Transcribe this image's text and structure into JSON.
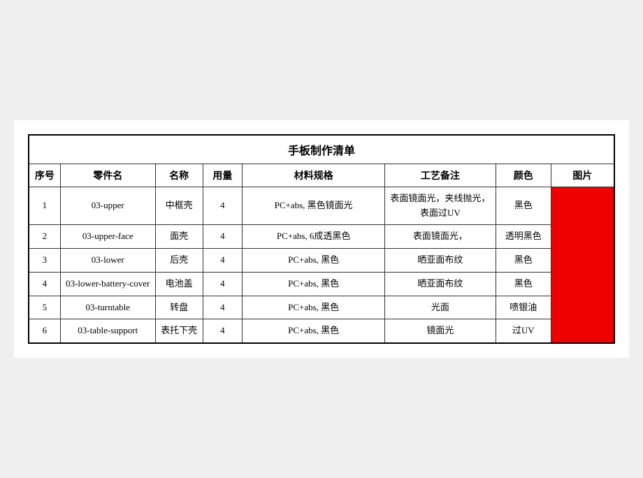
{
  "title": "手板制作清单",
  "headers": {
    "seq": "序号",
    "part_code": "零件名",
    "name": "名称",
    "qty": "用量",
    "spec": "材料规格",
    "process": "工艺备注",
    "color": "颜色",
    "image": "图片"
  },
  "rows": [
    {
      "seq": "1",
      "part_code": "03-upper",
      "name": "中框壳",
      "qty": "4",
      "spec": "PC+abs, 黑色镜面光",
      "process": "表面镜面光，夹线抛光，表面过UV",
      "color": "黑色"
    },
    {
      "seq": "2",
      "part_code": "03-upper-face",
      "name": "面壳",
      "qty": "4",
      "spec": "PC+abs, 6成透黑色",
      "process": "表面镜面光，",
      "color": "透明黑色"
    },
    {
      "seq": "3",
      "part_code": "03-lower",
      "name": "后壳",
      "qty": "4",
      "spec": "PC+abs, 黑色",
      "process": "晒亚面布纹",
      "color": "黑色"
    },
    {
      "seq": "4",
      "part_code": "03-lower-battery-cover",
      "name": "电池盖",
      "qty": "4",
      "spec": "PC+abs, 黑色",
      "process": "晒亚面布纹",
      "color": "黑色"
    },
    {
      "seq": "5",
      "part_code": "03-turntable",
      "name": "转盘",
      "qty": "4",
      "spec": "PC+abs, 黑色",
      "process": "光面",
      "color": "喷银油"
    },
    {
      "seq": "6",
      "part_code": "03-table-support",
      "name": "表托下壳",
      "qty": "4",
      "spec": "PC+abs, 黑色",
      "process": "镜面光",
      "color": "过UV"
    }
  ]
}
